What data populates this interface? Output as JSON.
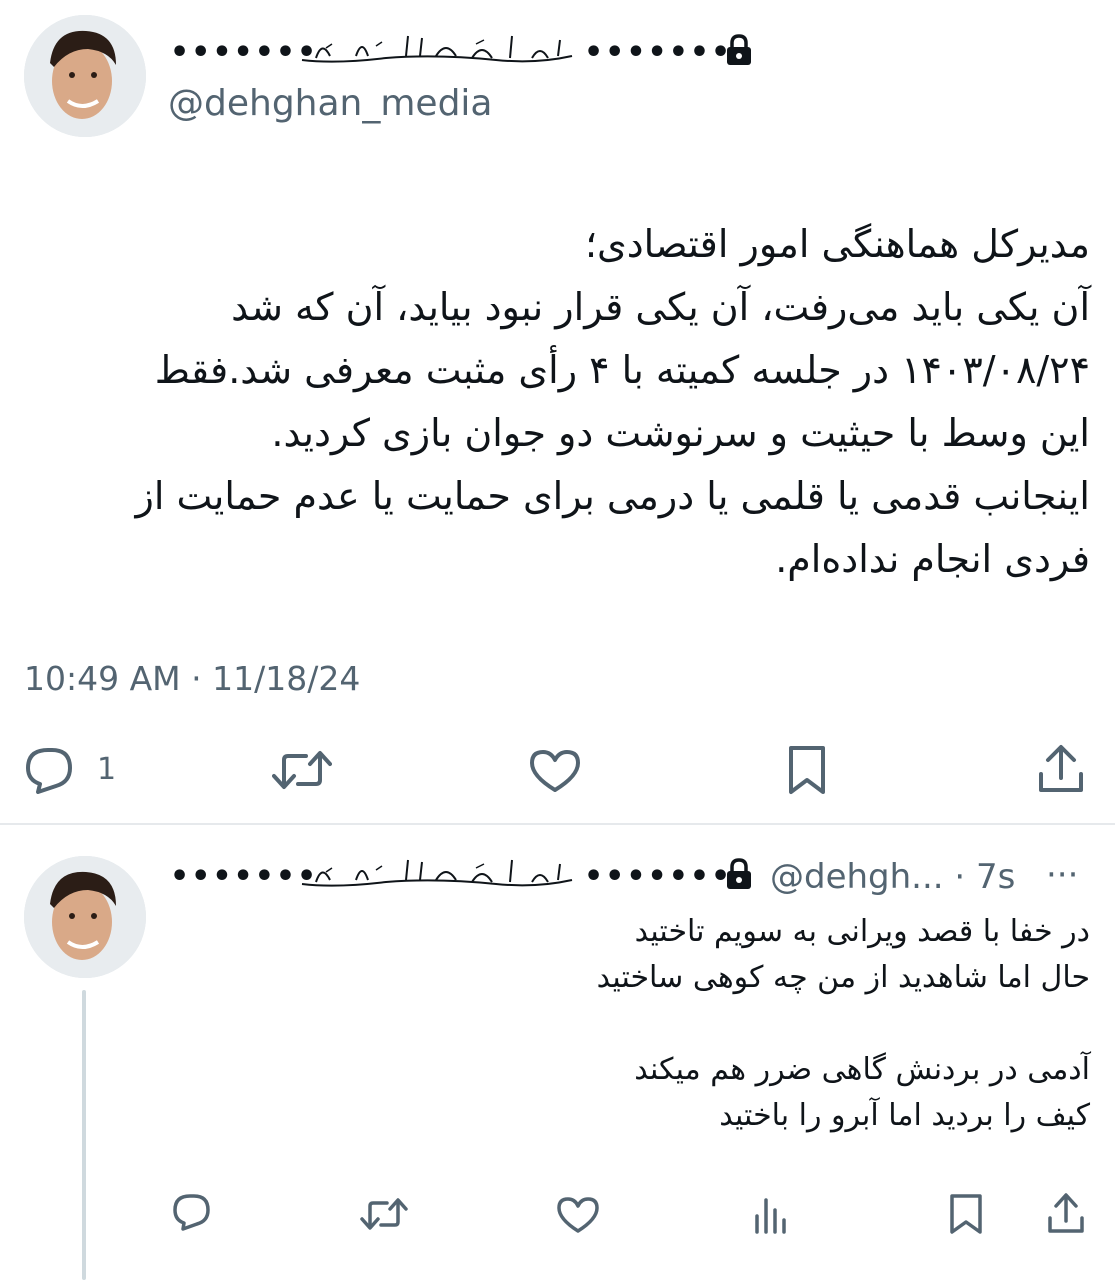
{
  "main_tweet": {
    "display_name_dots_left": "•••••••",
    "display_name_dots_right": "•••••••",
    "handle": "@dehghan_media",
    "text": "مدیرکل هماهنگی امور اقتصادی؛\nآن یکی باید می‌رفت، آن یکی قرار نبود بیاید، آن که شد\n۱۴۰۳/۰۸/۲۴ در جلسه کمیته با ۴ رأی مثبت معرفی شد.فقط\nاین وسط با حیثیت و سرنوشت دو جوان بازی کردید.\nاینجانب قدمی یا قلمی یا درمی برای حمایت یا عدم حمایت از\nفردی انجام نداده‌ام.",
    "timestamp": "10:49 AM · 11/18/24",
    "reply_count": "1",
    "icons": [
      "lock-icon",
      "reply-icon",
      "retweet-icon",
      "like-icon",
      "bookmark-icon",
      "share-icon"
    ]
  },
  "reply_tweet": {
    "display_name_dots_left": "•••••••",
    "display_name_dots_right": "•••••••",
    "handle_time": "@dehgh... · 7s",
    "more": "···",
    "text": "در خفا با قصد ویرانی به سویم تاختید\nحال اما شاهدید از من چه کوهی ساختید\n\nآدمی در بردنش گاهی ضرر هم میکند\nکیف را بردید اما آبرو را باختید",
    "icons": [
      "reply-icon",
      "retweet-icon",
      "like-icon",
      "views-icon",
      "bookmark-icon",
      "share-icon"
    ]
  },
  "colors": {
    "text": "#0f1419",
    "secondary": "#536471",
    "divider": "#e6e9ec"
  }
}
